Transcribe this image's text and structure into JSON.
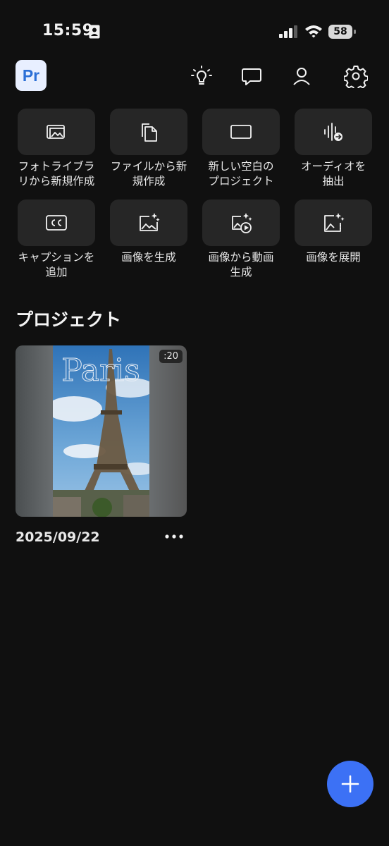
{
  "status_bar": {
    "time": "15:59",
    "battery": "58"
  },
  "app": {
    "logo_text": "Pr"
  },
  "quick_actions": [
    {
      "label_line1": "フォトライブラ",
      "label_line2": "リから新規作成",
      "icon": "photo-library-icon"
    },
    {
      "label_line1": "ファイルから新",
      "label_line2": "規作成",
      "icon": "files-icon"
    },
    {
      "label_line1": "新しい空白の",
      "label_line2": "プロジェクト",
      "icon": "blank-project-icon"
    },
    {
      "label_line1": "オーディオを",
      "label_line2": "抽出",
      "icon": "extract-audio-icon"
    },
    {
      "label_line1": "キャプションを",
      "label_line2": "追加",
      "icon": "captions-icon"
    },
    {
      "label_line1": "画像を生成",
      "label_line2": "",
      "icon": "generate-image-icon"
    },
    {
      "label_line1": "画像から動画",
      "label_line2": "生成",
      "icon": "image-to-video-icon"
    },
    {
      "label_line1": "画像を展開",
      "label_line2": "",
      "icon": "expand-image-icon"
    }
  ],
  "projects_section": {
    "title": "プロジェクト"
  },
  "projects": [
    {
      "date": "2025/09/22",
      "duration": ":20",
      "thumbnail_text": "Paris"
    }
  ],
  "colors": {
    "background": "#101010",
    "tile": "#262626",
    "fab": "#3c71f5",
    "logo_text": "#2b6fd6"
  }
}
